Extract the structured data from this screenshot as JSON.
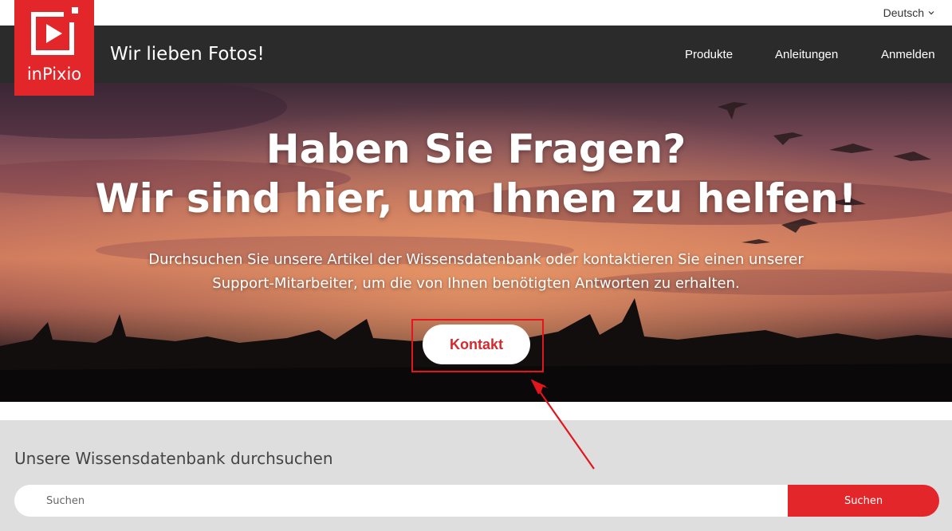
{
  "language_selector": {
    "value": "Deutsch",
    "icon": "chevron-down-icon"
  },
  "brand": {
    "name": "inPixio",
    "tagline": "Wir lieben Fotos!",
    "color": "#e3262a"
  },
  "nav": {
    "items": [
      {
        "label": "Produkte"
      },
      {
        "label": "Anleitungen"
      },
      {
        "label": "Anmelden"
      }
    ]
  },
  "hero": {
    "title_line1": "Haben Sie Fragen?",
    "title_line2": "Wir sind hier, um Ihnen zu helfen!",
    "text_line1": "Durchsuchen Sie unsere Artikel der Wissensdatenbank oder kontaktieren Sie einen unserer",
    "text_line2": "Support-Mitarbeiter, um die von Ihnen benötigten Antworten zu erhalten.",
    "contact_label": "Kontakt"
  },
  "knowledge_base": {
    "title": "Unsere Wissensdatenbank durchsuchen",
    "search_placeholder": "Suchen",
    "search_button": "Suchen"
  },
  "annotation": {
    "color": "#e3151d"
  }
}
